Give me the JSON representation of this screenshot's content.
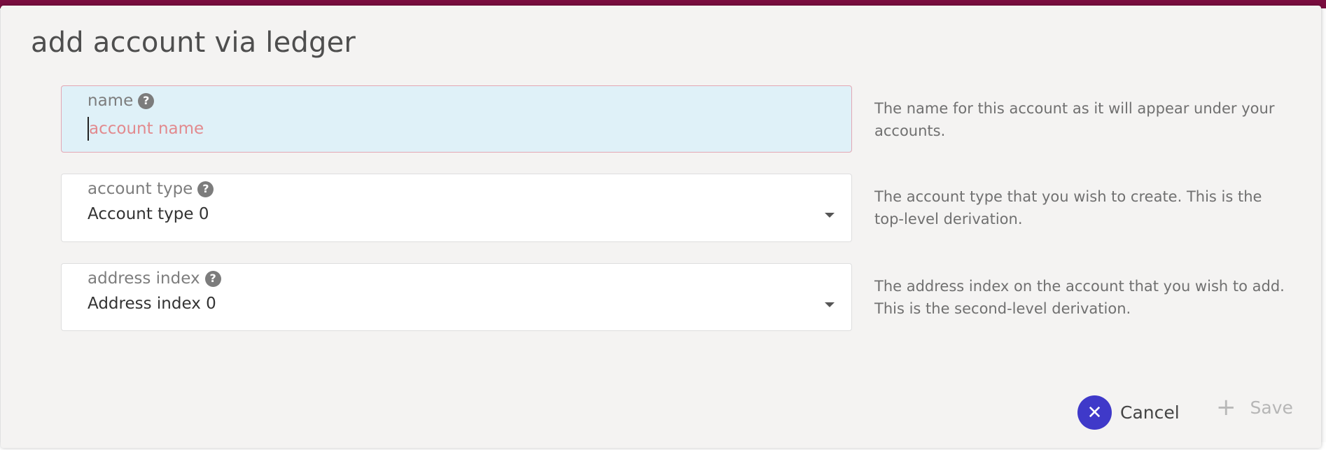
{
  "dialog": {
    "title": "add account via ledger"
  },
  "fields": {
    "name": {
      "label": "name",
      "placeholder": "account name",
      "value": "",
      "help": "The name for this account as it will appear under your accounts."
    },
    "account_type": {
      "label": "account type",
      "value": "Account type 0",
      "help": "The account type that you wish to create. This is the top-level derivation."
    },
    "address_index": {
      "label": "address index",
      "value": "Address index 0",
      "help": "The address index on the account that you wish to add. This is the second-level derivation."
    }
  },
  "actions": {
    "cancel_label": "Cancel",
    "save_label": "Save"
  },
  "icons": {
    "help": "question-circle-icon",
    "dropdown": "caret-down-icon",
    "cancel": "close-icon",
    "save": "plus-icon"
  },
  "colors": {
    "header_bar": "#7a0d3f",
    "cancel_button": "#3f39c9",
    "focused_field_bg": "#dff1f8",
    "placeholder": "#e28a8e"
  }
}
